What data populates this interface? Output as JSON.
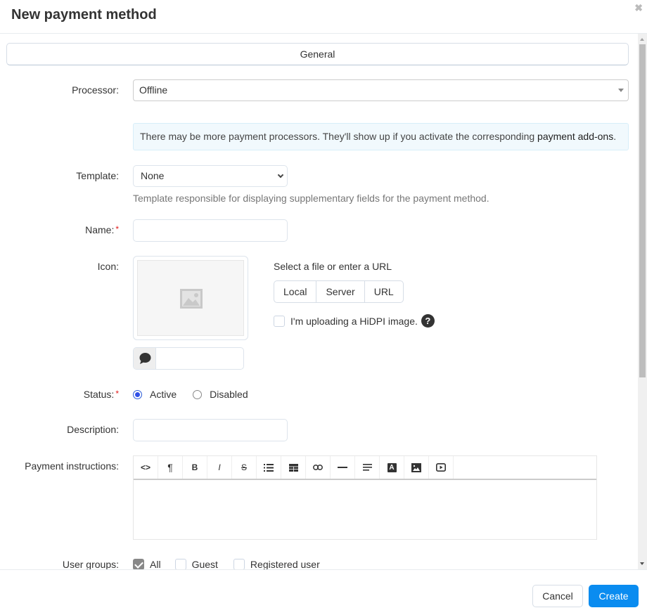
{
  "dialog": {
    "title": "New payment method",
    "close_icon": "close-icon"
  },
  "tabs": [
    {
      "label": "General",
      "active": true
    }
  ],
  "form": {
    "processor": {
      "label": "Processor:",
      "value": "Offline"
    },
    "notice": {
      "text": "There may be more payment processors. They'll show up if you activate the corresponding ",
      "link": "payment add-ons",
      "suffix": "."
    },
    "template": {
      "label": "Template:",
      "value": "None",
      "hint": "Template responsible for displaying supplementary fields for the payment method."
    },
    "name": {
      "label": "Name:",
      "required": "*",
      "value": ""
    },
    "icon": {
      "label": "Icon:",
      "select_text": "Select a file or enter a URL",
      "sources": [
        "Local",
        "Server",
        "URL"
      ],
      "hidpi_label": "I'm uploading a HiDPI image.",
      "hidpi_checked": false,
      "help": "?",
      "alt_value": ""
    },
    "status": {
      "label": "Status:",
      "required": "*",
      "options": [
        {
          "label": "Active",
          "selected": true
        },
        {
          "label": "Disabled",
          "selected": false
        }
      ]
    },
    "description": {
      "label": "Description:",
      "value": ""
    },
    "payment_instructions": {
      "label": "Payment instructions:",
      "toolbar": [
        "code-view",
        "paragraph",
        "bold",
        "italic",
        "strikethrough",
        "unordered-list",
        "table",
        "link",
        "horizontal-rule",
        "align",
        "text-color",
        "insert-image",
        "insert-video"
      ],
      "content": ""
    },
    "user_groups": {
      "label": "User groups:",
      "options": [
        {
          "label": "All",
          "checked": true
        },
        {
          "label": "Guest",
          "checked": false
        },
        {
          "label": "Registered user",
          "checked": false
        }
      ]
    }
  },
  "footer": {
    "cancel_label": "Cancel",
    "create_label": "Create"
  },
  "colors": {
    "primary": "#0a8cf0",
    "required": "#e01c1c",
    "notice_bg": "#f1f9fd"
  }
}
